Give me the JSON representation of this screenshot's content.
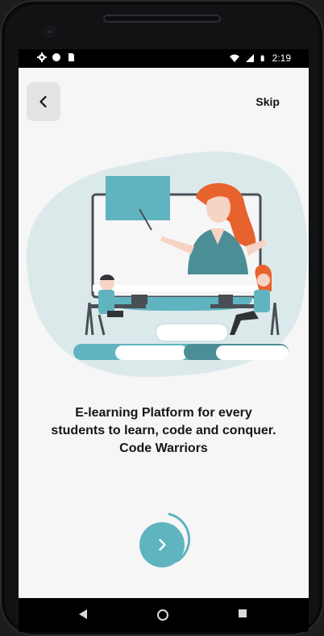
{
  "status_bar": {
    "time": "2:19",
    "icons": [
      "gear-icon",
      "circle-icon",
      "sd-card-icon",
      "wifi-icon",
      "signal-icon",
      "battery-icon"
    ]
  },
  "header": {
    "back_icon": "chevron-left-icon",
    "skip_label": "Skip"
  },
  "main": {
    "illustration": "e-learning-classroom-illustration",
    "headline_lines": [
      "E-learning Platform for every",
      "students to learn, code and conquer.",
      "Code Warriors"
    ],
    "next_icon": "chevron-right-icon"
  },
  "nav_bar": {
    "buttons": [
      "back-triangle-icon",
      "home-circle-icon",
      "recents-square-icon"
    ]
  },
  "colors": {
    "accent": "#5fb4bf",
    "blob": "#dce9eb",
    "hair": "#e8622e",
    "screen_bg": "#f6f6f6"
  }
}
